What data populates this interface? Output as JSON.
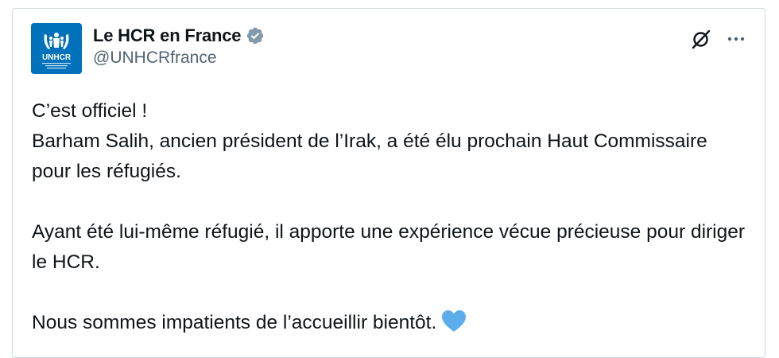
{
  "author": {
    "display_name": "Le HCR en France",
    "handle": "@UNHCRfrance",
    "avatar_text": "UNHCR",
    "verified_icon": "verified-badge-icon",
    "brand_color": "#0072bc"
  },
  "actions": {
    "grok_icon": "grok-icon",
    "more_icon": "more-options-icon"
  },
  "tweet": {
    "line1": "C’est officiel !",
    "line2": "Barham Salih, ancien président de l’Irak, a été élu prochain Haut Commissaire pour les réfugiés.",
    "line3": "Ayant été lui-même réfugié, il apporte une expérience vécue précieuse pour diriger le HCR.",
    "line4": "Nous sommes impatients de l’accueillir bientôt.",
    "emoji": "blue-heart-icon"
  },
  "colors": {
    "text": "#0f1419",
    "secondary": "#536471",
    "border": "#cfd9de",
    "heart": "#5cadec"
  }
}
